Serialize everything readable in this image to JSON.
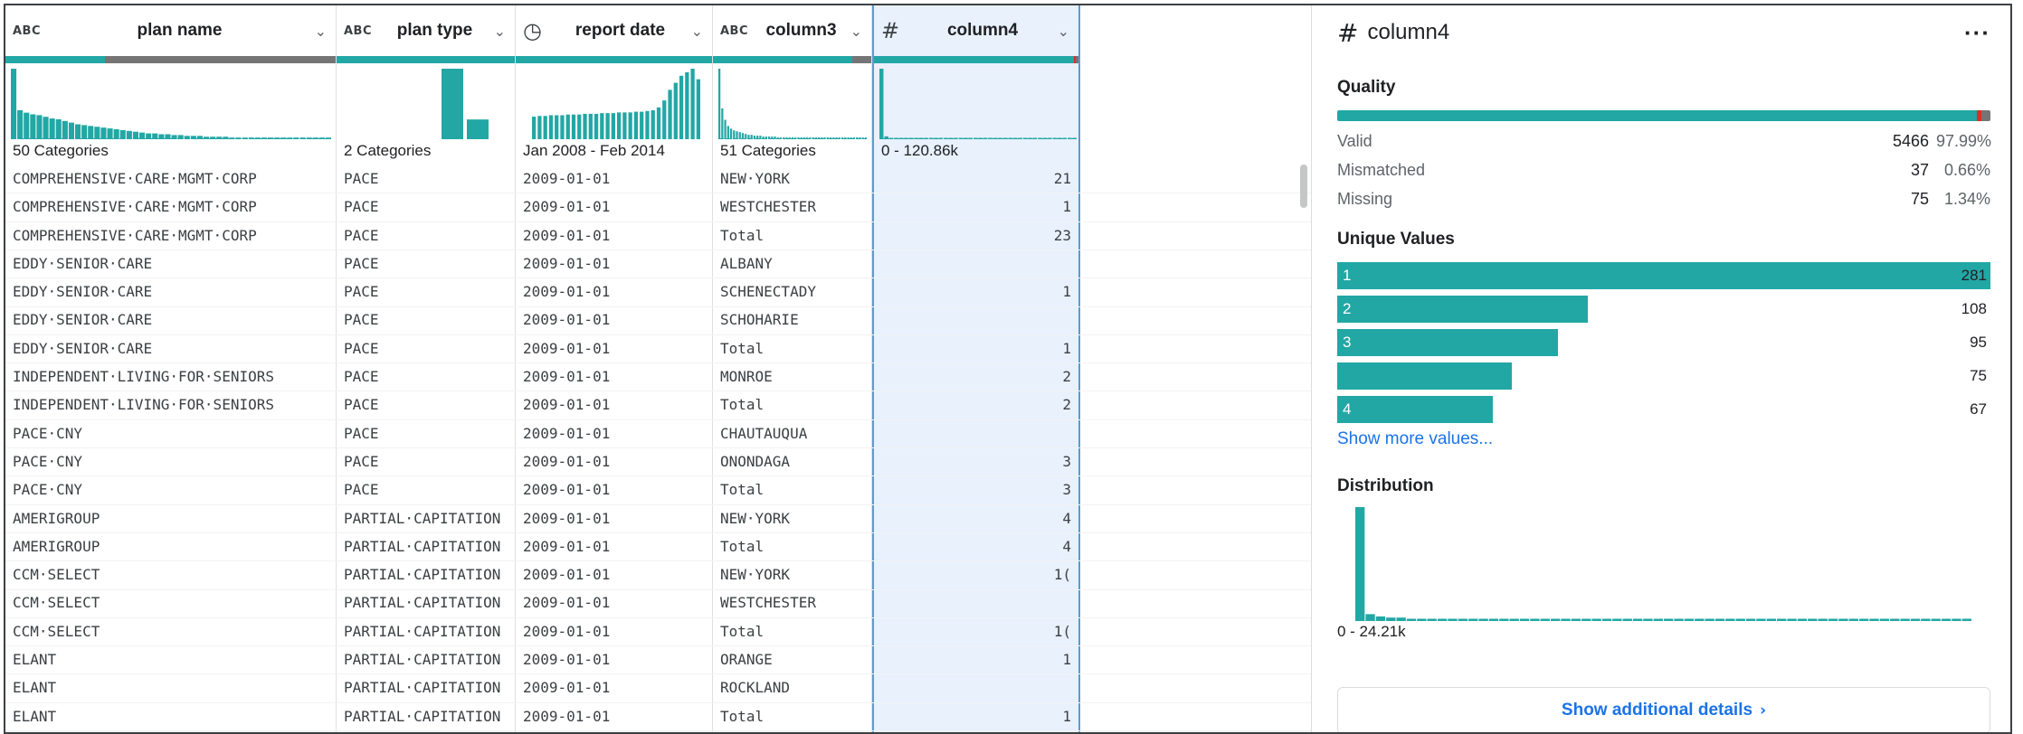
{
  "colors": {
    "accent": "#22a7a5",
    "mismatch": "#d93025",
    "missing": "#757575",
    "link": "#1a73e8"
  },
  "columns": [
    {
      "id": "plan_name",
      "type_icon": "abc-icon",
      "type_label": "ABC",
      "title": "plan name",
      "hist_label": "50 Categories",
      "quality": {
        "valid": 30,
        "missing": 70
      },
      "hist": [
        85,
        35,
        32,
        30,
        29,
        27,
        25,
        24,
        22,
        20,
        18,
        17,
        16,
        15,
        14,
        13,
        12,
        11,
        10,
        9,
        8,
        7,
        7,
        6,
        6,
        5,
        5,
        4,
        4,
        4,
        3,
        3,
        3,
        3,
        2,
        2,
        2,
        2,
        2,
        2,
        2,
        2,
        2,
        2,
        2,
        2,
        2,
        2,
        2,
        2
      ]
    },
    {
      "id": "plan_type",
      "type_icon": "abc-icon",
      "type_label": "ABC",
      "title": "plan type",
      "hist_label": "2 Categories",
      "quality": {
        "valid": 100,
        "missing": 0
      },
      "hist": [
        100,
        28
      ]
    },
    {
      "id": "report_date",
      "type_icon": "clock-icon",
      "type_label": "◷",
      "title": "report date",
      "hist_label": "Jan 2008 - Feb 2014",
      "quality": {
        "valid": 100,
        "missing": 0
      },
      "hist": [
        32,
        33,
        33,
        34,
        34,
        34,
        35,
        35,
        35,
        36,
        36,
        36,
        37,
        37,
        37,
        38,
        38,
        38,
        39,
        39,
        40,
        41,
        45,
        55,
        70,
        80,
        90,
        95,
        100,
        85
      ]
    },
    {
      "id": "column3",
      "type_icon": "abc-icon",
      "type_label": "ABC",
      "title": "column3",
      "hist_label": "51 Categories",
      "quality": {
        "valid": 88,
        "missing": 12
      },
      "hist": [
        80,
        35,
        22,
        15,
        12,
        10,
        9,
        8,
        7,
        6,
        5,
        5,
        4,
        4,
        4,
        3,
        3,
        3,
        3,
        3,
        2,
        2,
        2,
        2,
        2,
        2,
        2,
        2,
        2,
        2,
        2,
        2,
        2,
        2,
        2,
        2,
        2,
        2,
        2,
        2,
        2,
        2,
        2,
        2,
        2,
        2,
        2,
        2,
        2,
        2,
        2
      ]
    },
    {
      "id": "column4",
      "type_icon": "hash-icon",
      "type_label": "#",
      "title": "column4",
      "hist_label": "0 - 120.86k",
      "quality": {
        "valid": 97.99,
        "mismatch": 0.66,
        "missing": 1.34
      },
      "hist": [
        100,
        4,
        1,
        1,
        1,
        1,
        1,
        1,
        1,
        1,
        1,
        1,
        1,
        1,
        1,
        1,
        1,
        1,
        1,
        1,
        1,
        1,
        1,
        1,
        1,
        1,
        1,
        1,
        1,
        1,
        1,
        1,
        1,
        1,
        1,
        1,
        1,
        1,
        1,
        1
      ]
    }
  ],
  "rows": [
    [
      "COMPREHENSIVE·CARE·MGMT·CORP",
      "PACE",
      "2009-01-01",
      "NEW·YORK",
      "21"
    ],
    [
      "COMPREHENSIVE·CARE·MGMT·CORP",
      "PACE",
      "2009-01-01",
      "WESTCHESTER",
      "1"
    ],
    [
      "COMPREHENSIVE·CARE·MGMT·CORP",
      "PACE",
      "2009-01-01",
      "Total",
      "23"
    ],
    [
      "EDDY·SENIOR·CARE",
      "PACE",
      "2009-01-01",
      "ALBANY",
      ""
    ],
    [
      "EDDY·SENIOR·CARE",
      "PACE",
      "2009-01-01",
      "SCHENECTADY",
      "1"
    ],
    [
      "EDDY·SENIOR·CARE",
      "PACE",
      "2009-01-01",
      "SCHOHARIE",
      ""
    ],
    [
      "EDDY·SENIOR·CARE",
      "PACE",
      "2009-01-01",
      "Total",
      "1"
    ],
    [
      "INDEPENDENT·LIVING·FOR·SENIORS",
      "PACE",
      "2009-01-01",
      "MONROE",
      "2"
    ],
    [
      "INDEPENDENT·LIVING·FOR·SENIORS",
      "PACE",
      "2009-01-01",
      "Total",
      "2"
    ],
    [
      "PACE·CNY",
      "PACE",
      "2009-01-01",
      "CHAUTAUQUA",
      ""
    ],
    [
      "PACE·CNY",
      "PACE",
      "2009-01-01",
      "ONONDAGA",
      "3"
    ],
    [
      "PACE·CNY",
      "PACE",
      "2009-01-01",
      "Total",
      "3"
    ],
    [
      "AMERIGROUP",
      "PARTIAL·CAPITATION",
      "2009-01-01",
      "NEW·YORK",
      "4"
    ],
    [
      "AMERIGROUP",
      "PARTIAL·CAPITATION",
      "2009-01-01",
      "Total",
      "4"
    ],
    [
      "CCM·SELECT",
      "PARTIAL·CAPITATION",
      "2009-01-01",
      "NEW·YORK",
      "1("
    ],
    [
      "CCM·SELECT",
      "PARTIAL·CAPITATION",
      "2009-01-01",
      "WESTCHESTER",
      ""
    ],
    [
      "CCM·SELECT",
      "PARTIAL·CAPITATION",
      "2009-01-01",
      "Total",
      "1("
    ],
    [
      "ELANT",
      "PARTIAL·CAPITATION",
      "2009-01-01",
      "ORANGE",
      "1"
    ],
    [
      "ELANT",
      "PARTIAL·CAPITATION",
      "2009-01-01",
      "ROCKLAND",
      ""
    ],
    [
      "ELANT",
      "PARTIAL·CAPITATION",
      "2009-01-01",
      "Total",
      "1"
    ]
  ],
  "panel": {
    "title": "column4",
    "more_label": "···",
    "quality_heading": "Quality",
    "quality": [
      {
        "label": "Valid",
        "count": "5466",
        "pct": "97.99%"
      },
      {
        "label": "Mismatched",
        "count": "37",
        "pct": "0.66%"
      },
      {
        "label": "Missing",
        "count": "75",
        "pct": "1.34%"
      }
    ],
    "unique_heading": "Unique Values",
    "unique": [
      {
        "label": "1",
        "count": "281",
        "frac": 1.0
      },
      {
        "label": "2",
        "count": "108",
        "frac": 0.384
      },
      {
        "label": "3",
        "count": "95",
        "frac": 0.338
      },
      {
        "label": "",
        "count": "75",
        "frac": 0.267
      },
      {
        "label": "4",
        "count": "67",
        "frac": 0.238
      }
    ],
    "show_more": "Show more values...",
    "distribution_heading": "Distribution",
    "distribution_range": "0 - 24.21k",
    "distribution": [
      100,
      6,
      4,
      3,
      3,
      2,
      2,
      2,
      2,
      2,
      2,
      2,
      2,
      2,
      2,
      2,
      2,
      2,
      2,
      2,
      2,
      2,
      2,
      2,
      2,
      2,
      2,
      2,
      2,
      2,
      2,
      2,
      2,
      2,
      2,
      2,
      2,
      2,
      2,
      2,
      2,
      2,
      2,
      2,
      2,
      2,
      2,
      2,
      2,
      2,
      2,
      2,
      2,
      2,
      2,
      2,
      2,
      2,
      2,
      2
    ],
    "additional": "Show additional details"
  }
}
